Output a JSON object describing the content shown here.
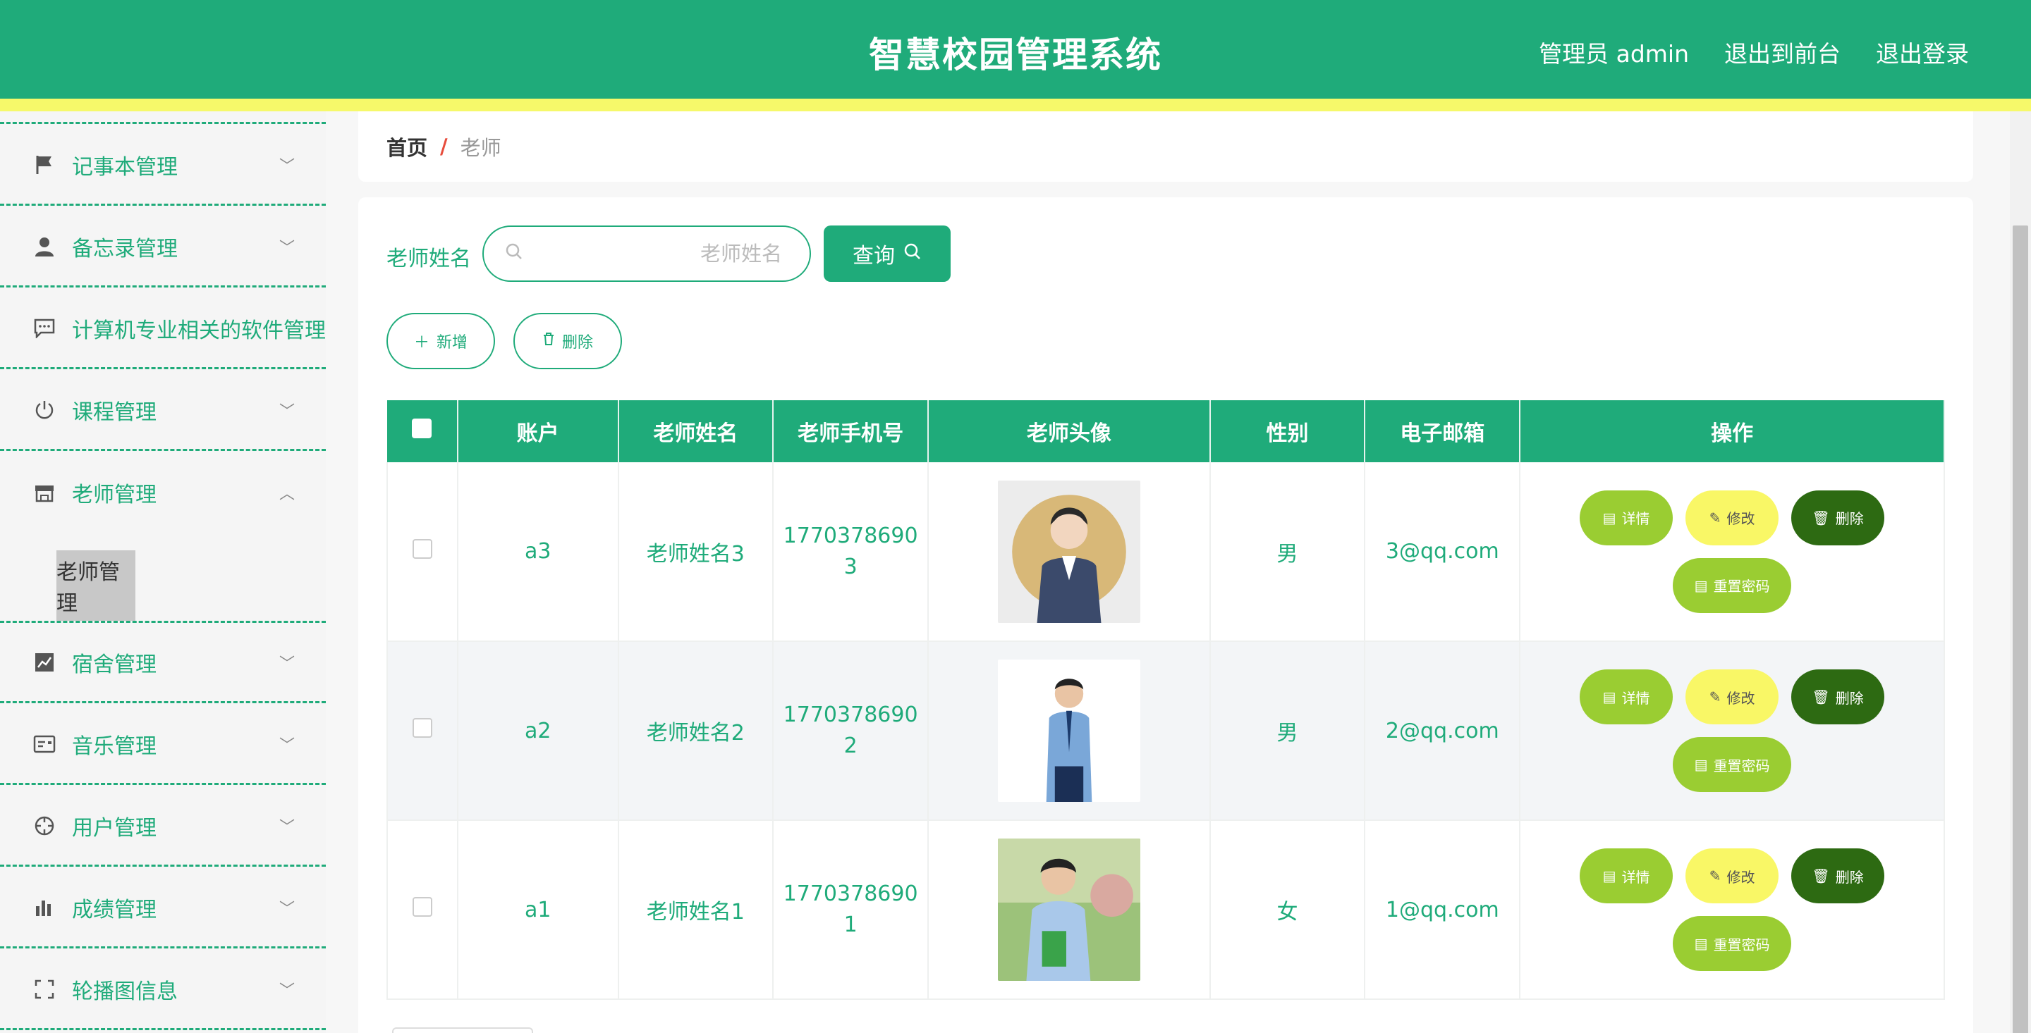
{
  "header": {
    "title": "智慧校园管理系统",
    "admin_label": "管理员 admin",
    "front_label": "退出到前台",
    "logout_label": "退出登录"
  },
  "sidebar": {
    "items": [
      {
        "label": "记事本管理",
        "icon": "flag-icon"
      },
      {
        "label": "备忘录管理",
        "icon": "user-icon"
      },
      {
        "label": "计算机专业相关的软件管理",
        "icon": "chat-icon"
      },
      {
        "label": "课程管理",
        "icon": "power-icon"
      },
      {
        "label": "老师管理",
        "icon": "store-icon"
      },
      {
        "label": "宿舍管理",
        "icon": "chart-icon"
      },
      {
        "label": "音乐管理",
        "icon": "card-icon"
      },
      {
        "label": "用户管理",
        "icon": "compass-icon"
      },
      {
        "label": "成绩管理",
        "icon": "bar-icon"
      },
      {
        "label": "轮播图信息",
        "icon": "fullscreen-icon"
      }
    ],
    "active_sub": "老师管理"
  },
  "breadcrumb": {
    "home": "首页",
    "sep": "/",
    "current": "老师"
  },
  "search": {
    "label": "老师姓名",
    "placeholder": "老师姓名",
    "query_label": "查询"
  },
  "actions": {
    "add_label": "新增",
    "delete_label": "删除"
  },
  "table": {
    "headers": [
      "账户",
      "老师姓名",
      "老师手机号",
      "老师头像",
      "性别",
      "电子邮箱",
      "操作"
    ],
    "rows": [
      {
        "account": "a3",
        "name": "老师姓名3",
        "phone_a": "1770378690",
        "phone_b": "3",
        "gender": "男",
        "email": "3@qq.com"
      },
      {
        "account": "a2",
        "name": "老师姓名2",
        "phone_a": "1770378690",
        "phone_b": "2",
        "gender": "男",
        "email": "2@qq.com"
      },
      {
        "account": "a1",
        "name": "老师姓名1",
        "phone_a": "1770378690",
        "phone_b": "1",
        "gender": "女",
        "email": "1@qq.com"
      }
    ],
    "ops": {
      "detail": "详情",
      "edit": "修改",
      "delete": "删除",
      "reset": "重置密码"
    }
  },
  "colors": {
    "primary": "#1fab7a",
    "strip": "#f6f96a",
    "detail": "#9acd32",
    "edit": "#f9f766",
    "delete": "#2d6a12"
  }
}
